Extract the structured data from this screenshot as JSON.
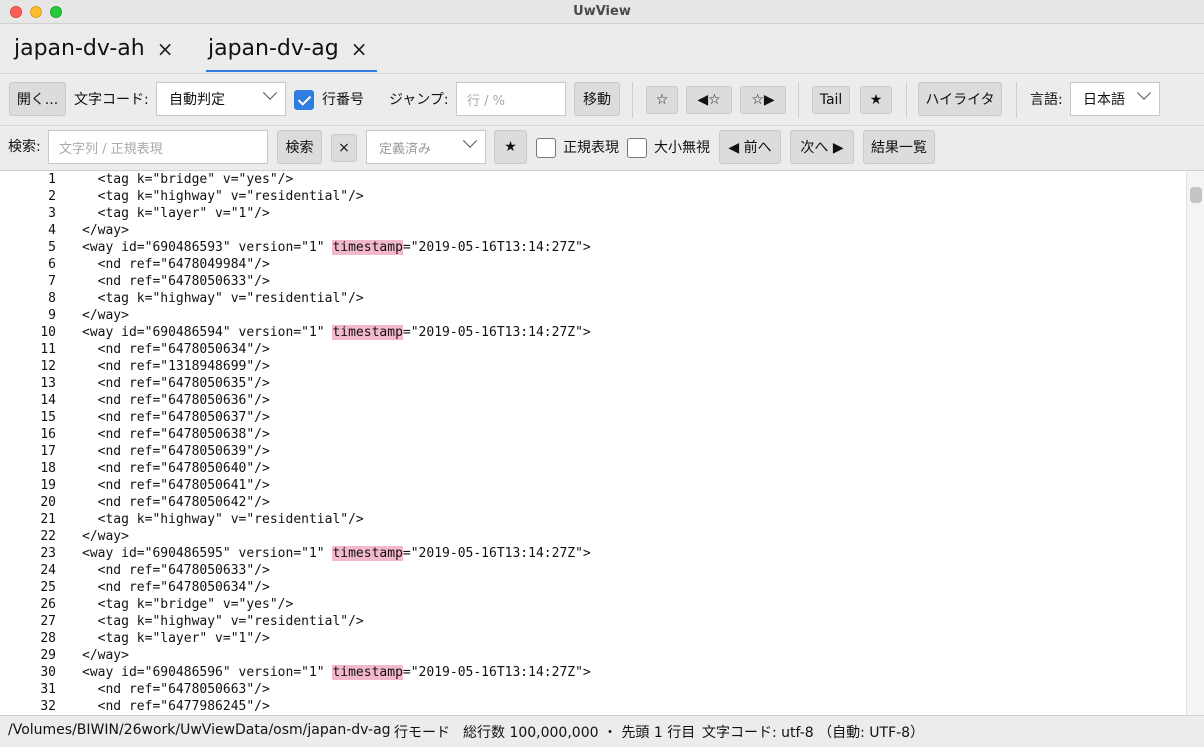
{
  "window": {
    "title": "UwView"
  },
  "tabs": [
    {
      "label": "japan-dv-ah",
      "close": "×",
      "active": false
    },
    {
      "label": "japan-dv-ag",
      "close": "×",
      "active": true
    }
  ],
  "toolbar1": {
    "open_label": "開く...",
    "encoding_label": "文字コード:",
    "encoding_value": "自動判定",
    "line_number_label": "行番号",
    "line_number_checked": true,
    "jump_label": "ジャンプ:",
    "jump_placeholder": "行 / %",
    "move_label": "移動",
    "bookmark_toggle": "☆",
    "bookmark_prev": "◀☆",
    "bookmark_next": "☆▶",
    "tail_label": "Tail",
    "star_label": "★",
    "highlighter_label": "ハイライタ",
    "language_label": "言語:",
    "language_value": "日本語"
  },
  "toolbar2": {
    "search_label": "検索:",
    "search_placeholder": "文字列 / 正規表現",
    "search_button": "検索",
    "clear_button": "×",
    "preset_placeholder": "定義済み",
    "star_button": "★",
    "regex_label": "正規表現",
    "ignore_case_label": "大小無視",
    "prev_button": "◀ 前へ",
    "next_button": "次へ ▶",
    "results_button": "結果一覧"
  },
  "editor": {
    "highlight_term": "timestamp",
    "lines": [
      {
        "n": "1",
        "text": "  <tag k=\"bridge\" v=\"yes\"/>"
      },
      {
        "n": "2",
        "text": "  <tag k=\"highway\" v=\"residential\"/>"
      },
      {
        "n": "3",
        "text": "  <tag k=\"layer\" v=\"1\"/>"
      },
      {
        "n": "4",
        "text": "</way>"
      },
      {
        "n": "5",
        "text": "<way id=\"690486593\" version=\"1\" timestamp=\"2019-05-16T13:14:27Z\">"
      },
      {
        "n": "6",
        "text": "  <nd ref=\"6478049984\"/>"
      },
      {
        "n": "7",
        "text": "  <nd ref=\"6478050633\"/>"
      },
      {
        "n": "8",
        "text": "  <tag k=\"highway\" v=\"residential\"/>"
      },
      {
        "n": "9",
        "text": "</way>"
      },
      {
        "n": "10",
        "text": "<way id=\"690486594\" version=\"1\" timestamp=\"2019-05-16T13:14:27Z\">"
      },
      {
        "n": "11",
        "text": "  <nd ref=\"6478050634\"/>"
      },
      {
        "n": "12",
        "text": "  <nd ref=\"1318948699\"/>"
      },
      {
        "n": "13",
        "text": "  <nd ref=\"6478050635\"/>"
      },
      {
        "n": "14",
        "text": "  <nd ref=\"6478050636\"/>"
      },
      {
        "n": "15",
        "text": "  <nd ref=\"6478050637\"/>"
      },
      {
        "n": "16",
        "text": "  <nd ref=\"6478050638\"/>"
      },
      {
        "n": "17",
        "text": "  <nd ref=\"6478050639\"/>"
      },
      {
        "n": "18",
        "text": "  <nd ref=\"6478050640\"/>"
      },
      {
        "n": "19",
        "text": "  <nd ref=\"6478050641\"/>"
      },
      {
        "n": "20",
        "text": "  <nd ref=\"6478050642\"/>"
      },
      {
        "n": "21",
        "text": "  <tag k=\"highway\" v=\"residential\"/>"
      },
      {
        "n": "22",
        "text": "</way>"
      },
      {
        "n": "23",
        "text": "<way id=\"690486595\" version=\"1\" timestamp=\"2019-05-16T13:14:27Z\">"
      },
      {
        "n": "24",
        "text": "  <nd ref=\"6478050633\"/>"
      },
      {
        "n": "25",
        "text": "  <nd ref=\"6478050634\"/>"
      },
      {
        "n": "26",
        "text": "  <tag k=\"bridge\" v=\"yes\"/>"
      },
      {
        "n": "27",
        "text": "  <tag k=\"highway\" v=\"residential\"/>"
      },
      {
        "n": "28",
        "text": "  <tag k=\"layer\" v=\"1\"/>"
      },
      {
        "n": "29",
        "text": "</way>"
      },
      {
        "n": "30",
        "text": "<way id=\"690486596\" version=\"1\" timestamp=\"2019-05-16T13:14:27Z\">"
      },
      {
        "n": "31",
        "text": "  <nd ref=\"6478050663\"/>"
      },
      {
        "n": "32",
        "text": "  <nd ref=\"6477986245\"/>"
      }
    ]
  },
  "status": {
    "path": "/Volumes/BIWIN/26work/UwViewData/osm/japan-dv-ag",
    "mode": "行モード",
    "info": "総行数 100,000,000 ・ 先頭 1 行目",
    "encoding": "文字コード: utf-8 （自動: UTF-8）"
  }
}
